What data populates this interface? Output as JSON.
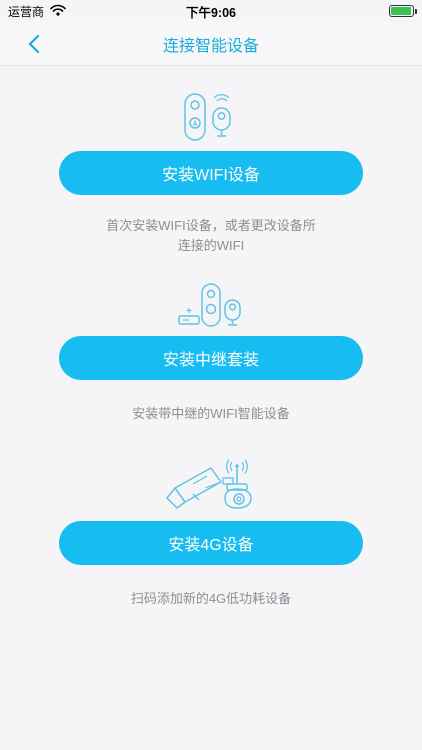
{
  "status_bar": {
    "carrier": "运营商",
    "time": "下午9:06",
    "battery_level": 0.95,
    "wifi_icon": "wifi-icon",
    "battery_icon": "battery-icon"
  },
  "nav": {
    "title": "连接智能设备",
    "back_icon": "chevron-left-icon"
  },
  "sections": [
    {
      "illustration": "doorbell-and-camera-icon",
      "button_label": "安装WIFI设备",
      "description_line1": "首次安装WIFI设备，或者更改设备所",
      "description_line2": "连接的WIFI"
    },
    {
      "illustration": "repeater-kit-icon",
      "button_label": "安装中继套装",
      "description_line1": "安装带中继的WIFI智能设备",
      "description_line2": ""
    },
    {
      "illustration": "4g-cameras-icon",
      "button_label": "安装4G设备",
      "description_line1": "扫码添加新的4G低功耗设备",
      "description_line2": ""
    }
  ],
  "colors": {
    "accent": "#17bdf0",
    "title": "#1aabd8",
    "icon_stroke": "#5fc4e6",
    "description": "#8e8e93",
    "background": "#f5f5f7"
  }
}
